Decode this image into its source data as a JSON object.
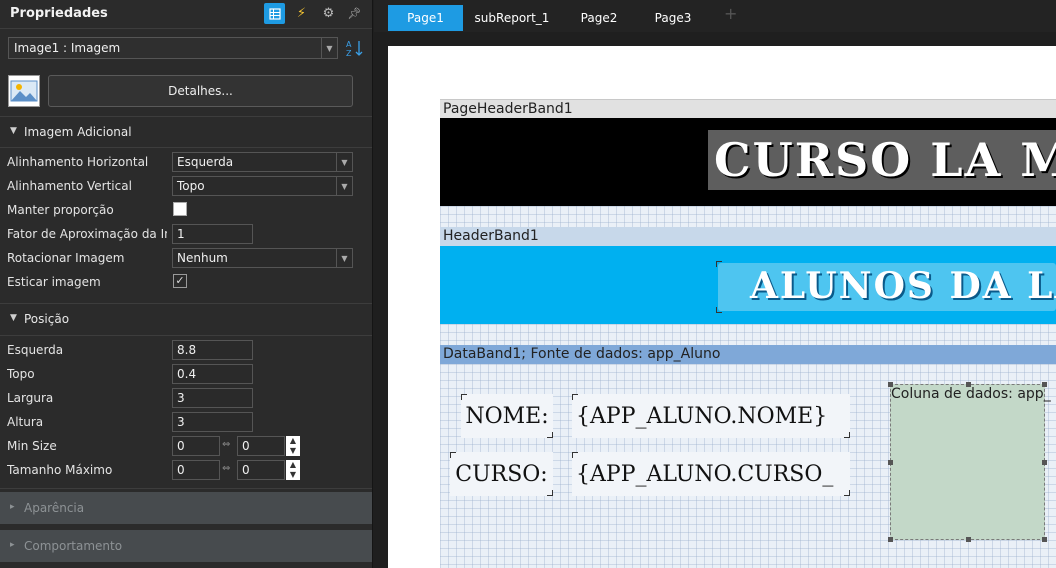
{
  "properties_panel": {
    "title": "Propriedades",
    "object_selector": "Image1 : Imagem",
    "details_button": "Detalhes...",
    "sections": {
      "imagem_adicional": {
        "title": "Imagem Adicional",
        "rows": {
          "alinhamento_horizontal": {
            "label": "Alinhamento Horizontal",
            "value": "Esquerda"
          },
          "alinhamento_vertical": {
            "label": "Alinhamento Vertical",
            "value": "Topo"
          },
          "manter_proporcao": {
            "label": "Manter proporção",
            "checked": false
          },
          "fator_aproximacao": {
            "label": "Fator de Aproximação da Imagem",
            "value": "1"
          },
          "rotacionar_imagem": {
            "label": "Rotacionar Imagem",
            "value": "Nenhum"
          },
          "esticar_imagem": {
            "label": "Esticar imagem",
            "checked": true
          }
        }
      },
      "posicao": {
        "title": "Posição",
        "rows": {
          "esquerda": {
            "label": "Esquerda",
            "value": "8.8"
          },
          "topo": {
            "label": "Topo",
            "value": "0.4"
          },
          "largura": {
            "label": "Largura",
            "value": "3"
          },
          "altura": {
            "label": "Altura",
            "value": "3"
          },
          "min_size": {
            "label": "Min Size",
            "value1": "0",
            "value2": "0"
          },
          "tamanho_maximo": {
            "label": "Tamanho Máximo",
            "value1": "0",
            "value2": "0"
          }
        }
      },
      "aparencia": {
        "title": "Aparência"
      },
      "comportamento": {
        "title": "Comportamento"
      }
    }
  },
  "tabs": [
    "Page1",
    "subReport_1",
    "Page2",
    "Page3"
  ],
  "active_tab": "Page1",
  "designer": {
    "page_header_band": {
      "label": "PageHeaderBand1",
      "title_text": "CURSO LA MARAVILHA"
    },
    "header_band": {
      "label": "HeaderBand1",
      "subtitle_text": "ALUNOS DA LA MARAVILHA"
    },
    "data_band": {
      "label": "DataBand1; Fonte de dados: app_Aluno",
      "nome_label": "NOME:",
      "nome_value": "{APP_ALUNO.NOME}",
      "curso_label": "CURSO:",
      "curso_value": "{APP_ALUNO.CURSO_",
      "column_label": "Coluna de dados: app_"
    }
  },
  "colors": {
    "accent": "#1e9be3",
    "page_header_bg": "#000000",
    "header_band_bg": "#00b0f0",
    "data_band_header": "#7fa8d8",
    "image_fill": "#c3d8c8"
  }
}
